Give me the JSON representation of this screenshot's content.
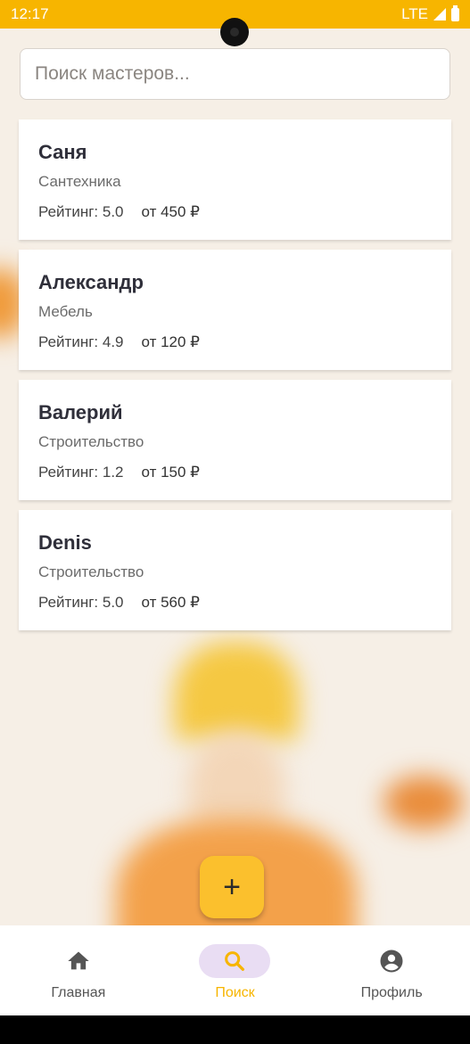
{
  "status": {
    "time": "12:17",
    "network": "LTE"
  },
  "search": {
    "placeholder": "Поиск мастеров..."
  },
  "masters": [
    {
      "name": "Саня",
      "category": "Сантехника",
      "rating": "Рейтинг: 5.0",
      "price": "от 450 ₽"
    },
    {
      "name": "Александр",
      "category": "Мебель",
      "rating": "Рейтинг: 4.9",
      "price": "от 120 ₽"
    },
    {
      "name": "Валерий",
      "category": "Строительство",
      "rating": "Рейтинг: 1.2",
      "price": "от 150 ₽"
    },
    {
      "name": "Denis",
      "category": "Строительство",
      "rating": "Рейтинг: 5.0",
      "price": "от 560 ₽"
    }
  ],
  "fab": {
    "icon": "plus-icon",
    "label": "+"
  },
  "nav": [
    {
      "label": "Главная",
      "icon": "home-icon",
      "active": false
    },
    {
      "label": "Поиск",
      "icon": "search-icon",
      "active": true
    },
    {
      "label": "Профиль",
      "icon": "account-circle-icon",
      "active": false
    }
  ],
  "colors": {
    "accent": "#f7b500",
    "fab": "#fbc02d",
    "active_pill": "#e9ddf3"
  }
}
